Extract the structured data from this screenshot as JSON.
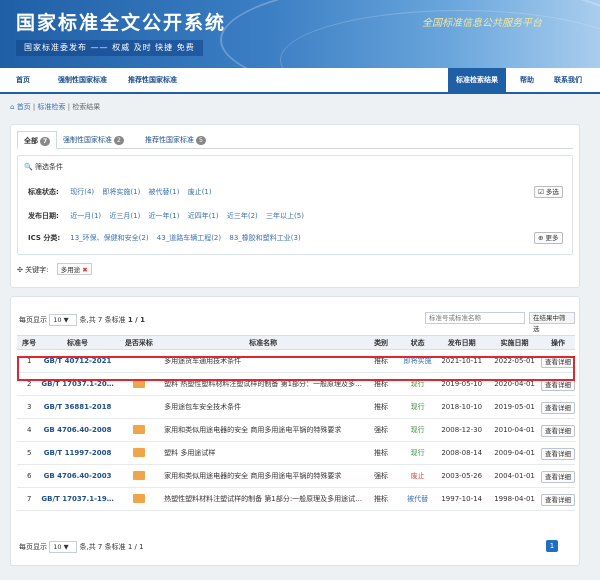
{
  "banner": {
    "title": "国家标准全文公开系统",
    "subtitle": "国家标准委发布 —— 权威 及时 快捷 免费",
    "slogan": "全国标准信息公共服务平台"
  },
  "nav": {
    "items": [
      "首页",
      "强制性国家标准",
      "推荐性国家标准"
    ],
    "right": [
      "标准检索结果",
      "帮助",
      "联系我们"
    ]
  },
  "breadcrumb": [
    "首页",
    "标准检索",
    "检索结果"
  ],
  "tabs": [
    {
      "label": "全部",
      "count": "7"
    },
    {
      "label": "强制性国家标准",
      "count": "2"
    },
    {
      "label": "推荐性国家标准",
      "count": "5"
    }
  ],
  "filter": {
    "heading": "筛选条件",
    "status_label": "标准状态:",
    "status_options": [
      "现行(4)",
      "即将实施(1)",
      "被代替(1)",
      "废止(1)"
    ],
    "multi_label": "多选",
    "date_label": "发布日期:",
    "date_options": [
      "近一月(1)",
      "近三月(1)",
      "近一年(1)",
      "近四年(1)",
      "近三年(2)",
      "三年以上(5)"
    ],
    "ics_label": "ICS 分类:",
    "ics_options": [
      "13_环保、保健和安全(2)",
      "43_道路车辆工程(2)",
      "83_橡胶和塑料工业(3)"
    ],
    "more_label": "更多",
    "keyword_label": "关键字:",
    "keyword_value": "多用途",
    "keyword_remove": "✖"
  },
  "results": {
    "per_page_label": "每页显示",
    "per_page_value": "10",
    "summary": "条,共 7 条标准",
    "page_info": "1 / 1",
    "search_placeholder": "标准号或标准名称",
    "search_button": "在结果中筛选",
    "headers": [
      "序号",
      "标准号",
      "是否采标",
      "标准名称",
      "类别",
      "状态",
      "发布日期",
      "实施日期",
      "操作"
    ],
    "view_label": "查看详细",
    "rows": [
      {
        "idx": "1",
        "code": "GB/T 40712-2021",
        "adopted": false,
        "name": "多用途货车通用技术条件",
        "type": "推标",
        "status": "即将实施",
        "status_kind": "upcoming",
        "pub": "2021-10-11",
        "impl": "2022-05-01"
      },
      {
        "idx": "2",
        "code": "GB/T 17037.1-20…",
        "adopted": true,
        "name": "塑料 热塑性塑料材料注塑试样的制备 第1部分：一般原理及多…",
        "type": "推标",
        "status": "现行",
        "status_kind": "current",
        "pub": "2019-05-10",
        "impl": "2020-04-01"
      },
      {
        "idx": "3",
        "code": "GB/T 36881-2018",
        "adopted": false,
        "name": "多用途包车安全技术条件",
        "type": "推标",
        "status": "现行",
        "status_kind": "current",
        "pub": "2018-10-10",
        "impl": "2019-05-01"
      },
      {
        "idx": "4",
        "code": "GB 4706.40-2008",
        "adopted": true,
        "name": "家用和类似用途电器的安全 商用多用途电平锅的特殊要求",
        "type": "强标",
        "status": "现行",
        "status_kind": "current",
        "pub": "2008-12-30",
        "impl": "2010-04-01"
      },
      {
        "idx": "5",
        "code": "GB/T 11997-2008",
        "adopted": true,
        "name": "塑料 多用途试样",
        "type": "推标",
        "status": "现行",
        "status_kind": "current",
        "pub": "2008-08-14",
        "impl": "2009-04-01"
      },
      {
        "idx": "6",
        "code": "GB 4706.40-2003",
        "adopted": true,
        "name": "家用和类似用途电器的安全 商用多用途电平锅的特殊要求",
        "type": "强标",
        "status": "废止",
        "status_kind": "abolished",
        "pub": "2003-05-26",
        "impl": "2004-01-01"
      },
      {
        "idx": "7",
        "code": "GB/T 17037.1-19…",
        "adopted": true,
        "name": "热塑性塑料材料注塑试样的制备 第1部分:一般原理及多用途试…",
        "type": "推标",
        "status": "被代替",
        "status_kind": "replaced",
        "pub": "1997-10-14",
        "impl": "1998-04-01"
      }
    ],
    "current_page": "1"
  },
  "colors": {
    "brand": "#1f5fa6",
    "highlight": "#e2262f",
    "adopted": "#f0a54b"
  }
}
